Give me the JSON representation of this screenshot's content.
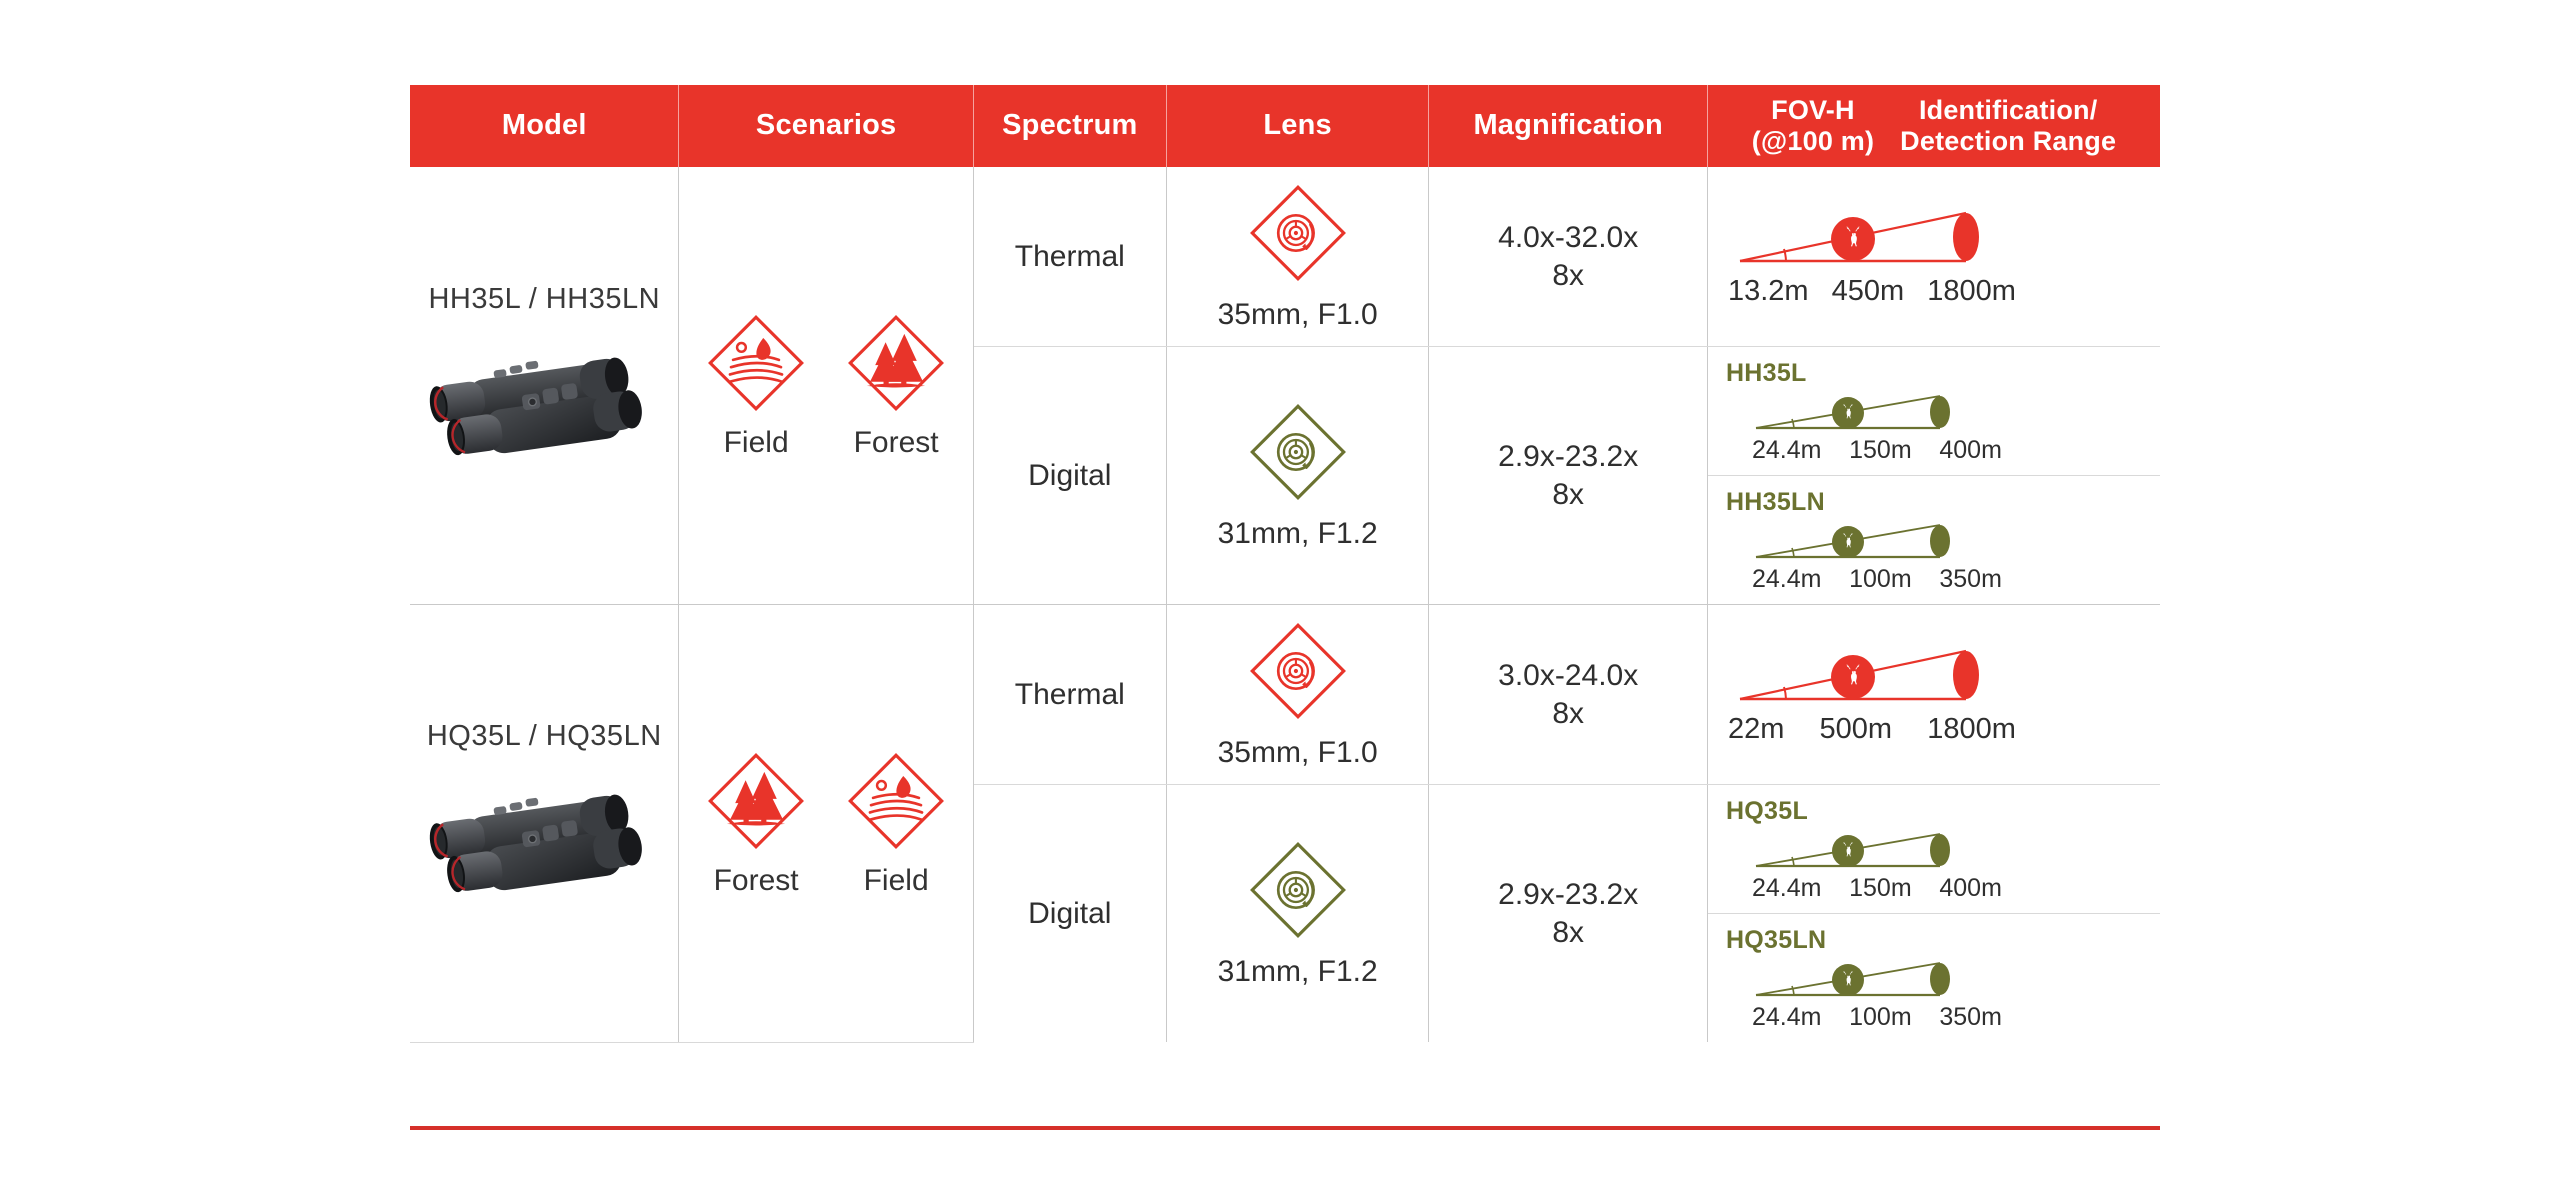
{
  "table": {
    "accent_red": "#E8342A",
    "accent_olive": "#6B7230",
    "headers": [
      {
        "id": "model",
        "label": "Model"
      },
      {
        "id": "scenarios",
        "label": "Scenarios"
      },
      {
        "id": "spectrum",
        "label": "Spectrum"
      },
      {
        "id": "lens",
        "label": "Lens"
      },
      {
        "id": "magnification",
        "label": "Magnification"
      },
      {
        "id": "fov",
        "label_line1": "FOV-H",
        "label_line2": "(@100 m)"
      },
      {
        "id": "range",
        "label_line1": "Identification/",
        "label_line2": "Detection Range"
      }
    ]
  },
  "rows": [
    {
      "model": "HH35L / HH35LN",
      "scenarios": [
        {
          "label": "Field",
          "icon": "field-diamond-icon"
        },
        {
          "label": "Forest",
          "icon": "forest-diamond-icon"
        }
      ],
      "thermal": {
        "spectrum": "Thermal",
        "lens": "35mm, F1.0",
        "lens_icon": "lens-aperture-diamond-icon",
        "magnification_range": "4.0x-32.0x",
        "magnification_digital": "8x",
        "cones": [
          {
            "model_label": "",
            "fov": "13.2m",
            "identification": "450m",
            "detection": "1800m",
            "color": "#E8342A"
          }
        ]
      },
      "digital": {
        "spectrum": "Digital",
        "lens": "31mm, F1.2",
        "lens_icon": "lens-aperture-diamond-icon",
        "magnification_range": "2.9x-23.2x",
        "magnification_digital": "8x",
        "cones": [
          {
            "model_label": "HH35L",
            "fov": "24.4m",
            "identification": "150m",
            "detection": "400m",
            "color": "#6B7230"
          },
          {
            "model_label": "HH35LN",
            "fov": "24.4m",
            "identification": "100m",
            "detection": "350m",
            "color": "#6B7230"
          }
        ]
      }
    },
    {
      "model": "HQ35L / HQ35LN",
      "scenarios": [
        {
          "label": "Forest",
          "icon": "forest-diamond-icon"
        },
        {
          "label": "Field",
          "icon": "field-diamond-icon"
        }
      ],
      "thermal": {
        "spectrum": "Thermal",
        "lens": "35mm, F1.0",
        "lens_icon": "lens-aperture-diamond-icon",
        "magnification_range": "3.0x-24.0x",
        "magnification_digital": "8x",
        "cones": [
          {
            "model_label": "",
            "fov": "22m",
            "identification": "500m",
            "detection": "1800m",
            "color": "#E8342A"
          }
        ]
      },
      "digital": {
        "spectrum": "Digital",
        "lens": "31mm, F1.2",
        "lens_icon": "lens-aperture-diamond-icon",
        "magnification_range": "2.9x-23.2x",
        "magnification_digital": "8x",
        "cones": [
          {
            "model_label": "HQ35L",
            "fov": "24.4m",
            "identification": "150m",
            "detection": "400m",
            "color": "#6B7230"
          },
          {
            "model_label": "HQ35LN",
            "fov": "24.4m",
            "identification": "100m",
            "detection": "350m",
            "color": "#6B7230"
          }
        ]
      }
    }
  ]
}
